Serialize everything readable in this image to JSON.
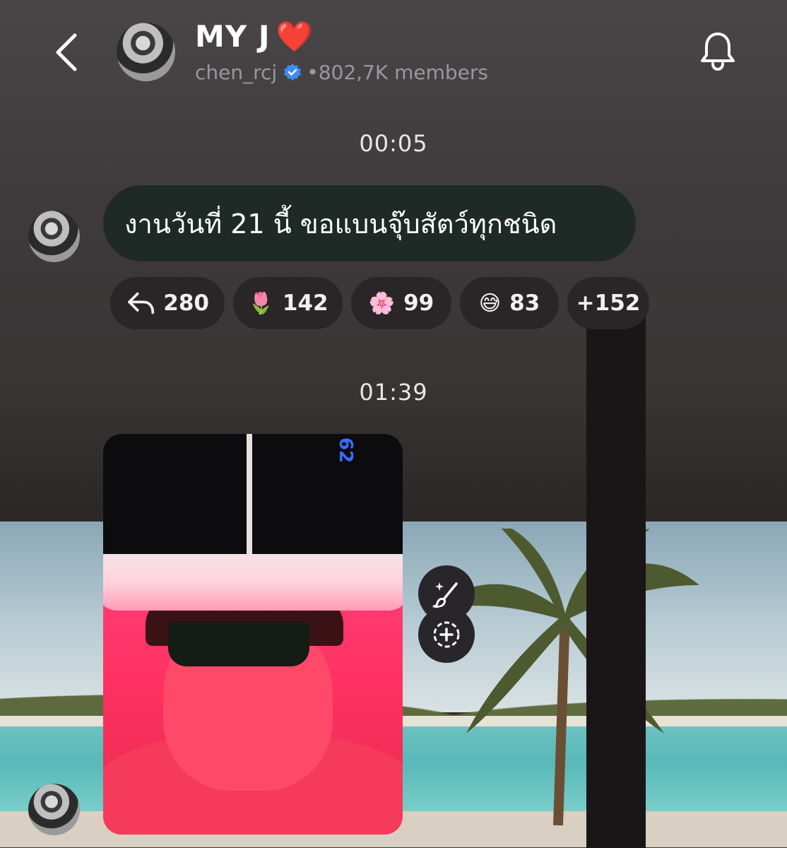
{
  "header": {
    "title": "MY J",
    "heart": "❤️",
    "username": "chen_rcj",
    "members": "•802,7K members",
    "icons": [
      "back-arrow-icon",
      "bell-icon",
      "verified-badge-icon"
    ],
    "accent_color": "#3b8ef0"
  },
  "messages": [
    {
      "time": "00:05",
      "text": "งานวันที่ 21 นี้ ขอแบนจุ๊บสัตว์ทุกชนิด",
      "reactions": [
        {
          "icon": "reply-icon",
          "count": "280"
        },
        {
          "emoji": "🌷",
          "count": "142"
        },
        {
          "emoji": "🌸",
          "count": "99"
        },
        {
          "emoji": "😅",
          "count": "83"
        },
        {
          "label": "+152"
        }
      ]
    },
    {
      "time": "01:39",
      "type": "photo",
      "photo_overlay_text": "62"
    }
  ],
  "tools": [
    "magic-brush-icon",
    "add-reaction-icon"
  ]
}
